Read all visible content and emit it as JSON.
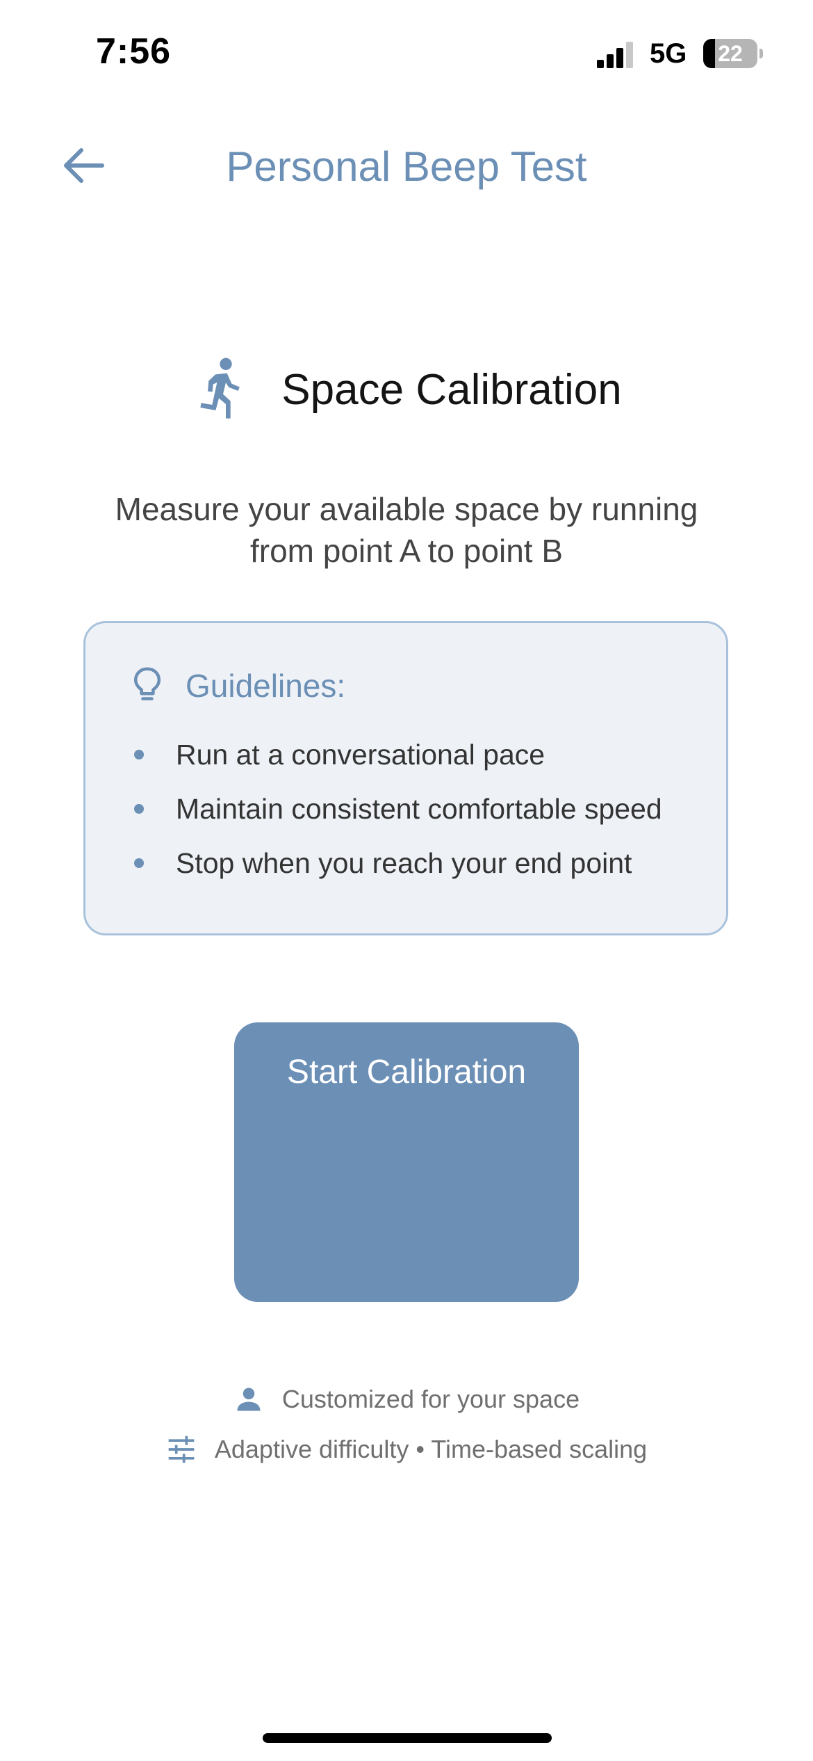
{
  "status_bar": {
    "time": "7:56",
    "network": "5G",
    "battery_level": "22",
    "battery_fraction": 0.22
  },
  "header": {
    "back_icon": "arrow-left-icon",
    "title": "Personal Beep Test"
  },
  "section": {
    "icon": "running-person-icon",
    "title": "Space Calibration",
    "description": "Measure your available space by running from point A to point B"
  },
  "guidelines": {
    "icon": "lightbulb-icon",
    "title": "Guidelines:",
    "items": [
      "Run at a conversational pace",
      "Maintain consistent comfortable speed",
      "Stop when you reach your end point"
    ]
  },
  "start_button": {
    "label": "Start Calibration"
  },
  "features": [
    {
      "icon": "person-icon",
      "text": "Customized for your space"
    },
    {
      "icon": "sliders-icon",
      "text": "Adaptive difficulty • Time-based scaling"
    }
  ],
  "colors": {
    "accent": "#6b8fb5",
    "card_bg": "#eef2f7",
    "card_border": "#a9c2dc",
    "muted_text": "#6f6f6f"
  }
}
